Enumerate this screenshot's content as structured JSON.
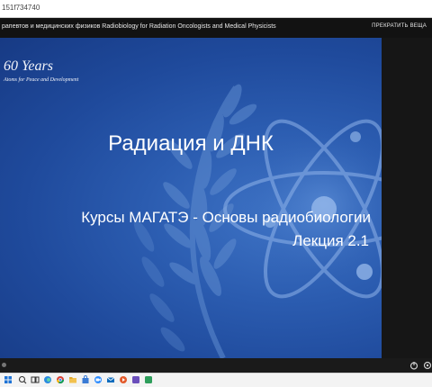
{
  "browser": {
    "url": "151f734740"
  },
  "meeting": {
    "title": "рапевтов и медицинских физиков Radiobiology for Radiation Oncologists and Medical Physicists",
    "end_label": "ПРЕКРАТИТЬ ВЕЩА"
  },
  "slide": {
    "brand_years": "60 Years",
    "brand_tagline": "Atoms for Peace and Development",
    "title": "Радиация и ДНК",
    "subtitle_line1": "Курсы МАГАТЭ - Основы радиобиологии",
    "subtitle_line2": "Лекция 2.1",
    "colors": {
      "background": "#2b5cb0",
      "text": "#ffffff"
    }
  },
  "controls": {
    "icons": [
      "power-icon",
      "settings-icon"
    ]
  },
  "taskbar": {
    "icons": [
      "start-icon",
      "search-icon",
      "task-view-icon",
      "edge-icon",
      "chrome-icon",
      "explorer-icon",
      "store-icon",
      "zoom-icon",
      "mail-icon",
      "media-icon",
      "app-icon",
      "app-icon-2"
    ]
  }
}
